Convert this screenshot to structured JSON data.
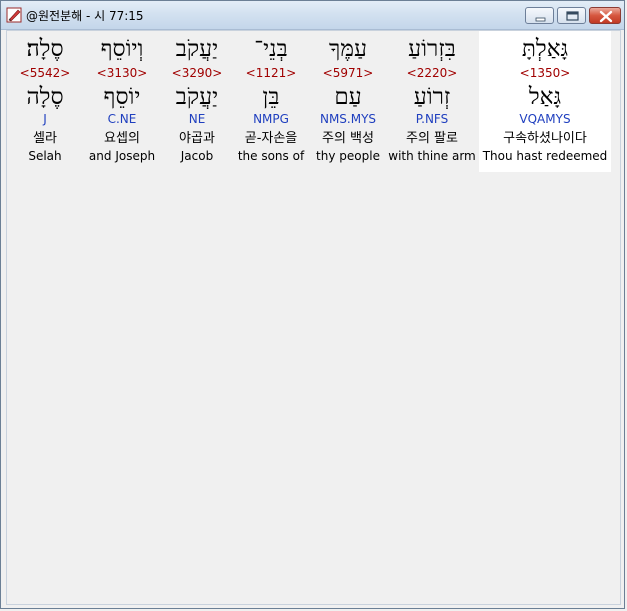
{
  "window": {
    "title": "@원전분해 - 시 77:15",
    "icons": {
      "app": "pen-app-icon",
      "minimize": "minimize-icon",
      "maximize": "maximize-icon",
      "close": "close-icon"
    }
  },
  "words": [
    {
      "hebrew": "סֶלָה׃",
      "strong": "<5542>",
      "root": "סֶלָה",
      "morph": "J",
      "korean": "셀라",
      "english": "Selah"
    },
    {
      "hebrew": "וְיוֹסֵף",
      "strong": "<3130>",
      "root": "יוֹסֵף",
      "morph": "C.NE",
      "korean": "요셉의",
      "english": "and Joseph"
    },
    {
      "hebrew": "יַעֲקֹב",
      "strong": "<3290>",
      "root": "יַעֲקֹב",
      "morph": "NE",
      "korean": "야곱과",
      "english": "Jacob"
    },
    {
      "hebrew": "בְּנֵי־",
      "strong": "<1121>",
      "root": "בֵּן",
      "morph": "NMPG",
      "korean": "곧-자손을",
      "english": "the sons of"
    },
    {
      "hebrew": "עַמֶּךָ",
      "strong": "<5971>",
      "root": "עַם",
      "morph": "NMS.MYS",
      "korean": "주의 백성",
      "english": "thy people"
    },
    {
      "hebrew": "בִּזְרוֹעַ",
      "strong": "<2220>",
      "root": "זְרוֹעַ",
      "morph": "P.NFS",
      "korean": "주의 팔로",
      "english": "with thine arm"
    },
    {
      "hebrew": "גָּאַלְתָּ",
      "strong": "<1350>",
      "root": "גָּאַל",
      "morph": "VQAMYS",
      "korean": "구속하셨나이다",
      "english": "Thou hast redeemed"
    }
  ]
}
